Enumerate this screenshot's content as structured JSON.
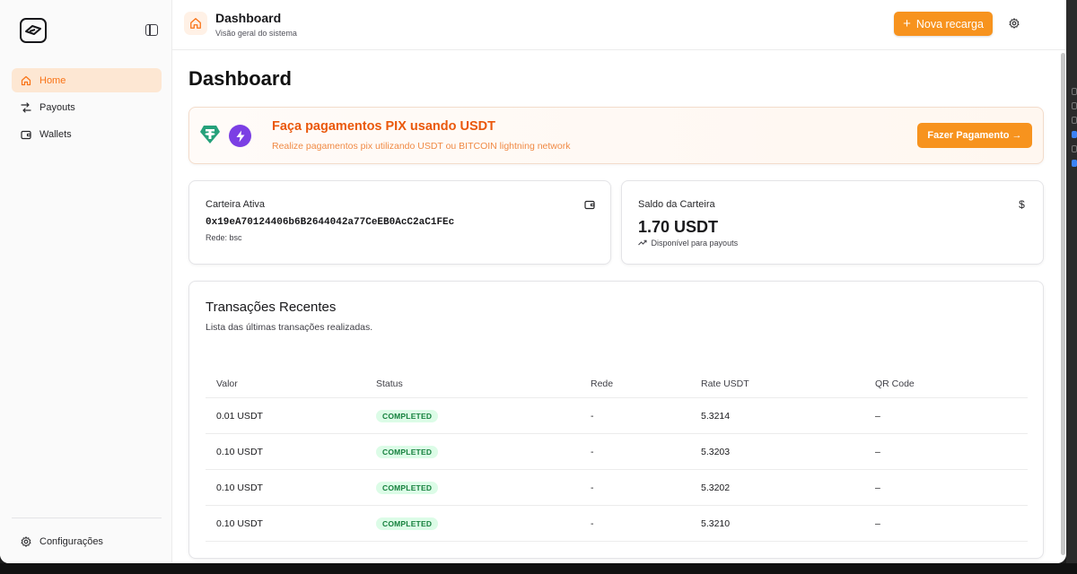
{
  "sidebar": {
    "items": [
      {
        "label": "Home",
        "icon": "home-icon",
        "active": true
      },
      {
        "label": "Payouts",
        "icon": "payouts-icon"
      },
      {
        "label": "Wallets",
        "icon": "wallet-icon"
      }
    ],
    "footer": {
      "label": "Configurações",
      "icon": "gear-icon"
    }
  },
  "header": {
    "title": "Dashboard",
    "subtitle": "Visão geral do sistema",
    "recarga_label": "Nova recarga"
  },
  "page": {
    "title": "Dashboard"
  },
  "banner": {
    "title": "Faça pagamentos PIX usando USDT",
    "subtitle": "Realize pagamentos pix utilizando USDT ou BITCOIN lightning network",
    "button_label": "Fazer Pagamento →"
  },
  "wallet_card": {
    "label": "Carteira Ativa",
    "address": "0x19eA70124406b6B2644042a77CeEB0AcC2aC1FEc",
    "network": "Rede: bsc"
  },
  "balance_card": {
    "label": "Saldo da Carteira",
    "amount": "1.70 USDT",
    "note": "Disponível para payouts"
  },
  "transactions": {
    "title": "Transações Recentes",
    "subtitle": "Lista das últimas transações realizadas.",
    "columns": [
      "Valor",
      "Status",
      "Rede",
      "Rate USDT",
      "QR Code"
    ],
    "rows": [
      [
        "0.01 USDT",
        "COMPLETED",
        "-",
        "5.3214",
        "–"
      ],
      [
        "0.10 USDT",
        "COMPLETED",
        "-",
        "5.3203",
        "–"
      ],
      [
        "0.10 USDT",
        "COMPLETED",
        "-",
        "5.3202",
        "–"
      ],
      [
        "0.10 USDT",
        "COMPLETED",
        "-",
        "5.3210",
        "–"
      ]
    ]
  },
  "colors": {
    "accent": "#f7931e",
    "accent_text": "#ea580c",
    "success_bg": "#dcfce7",
    "success_text": "#15803d"
  }
}
